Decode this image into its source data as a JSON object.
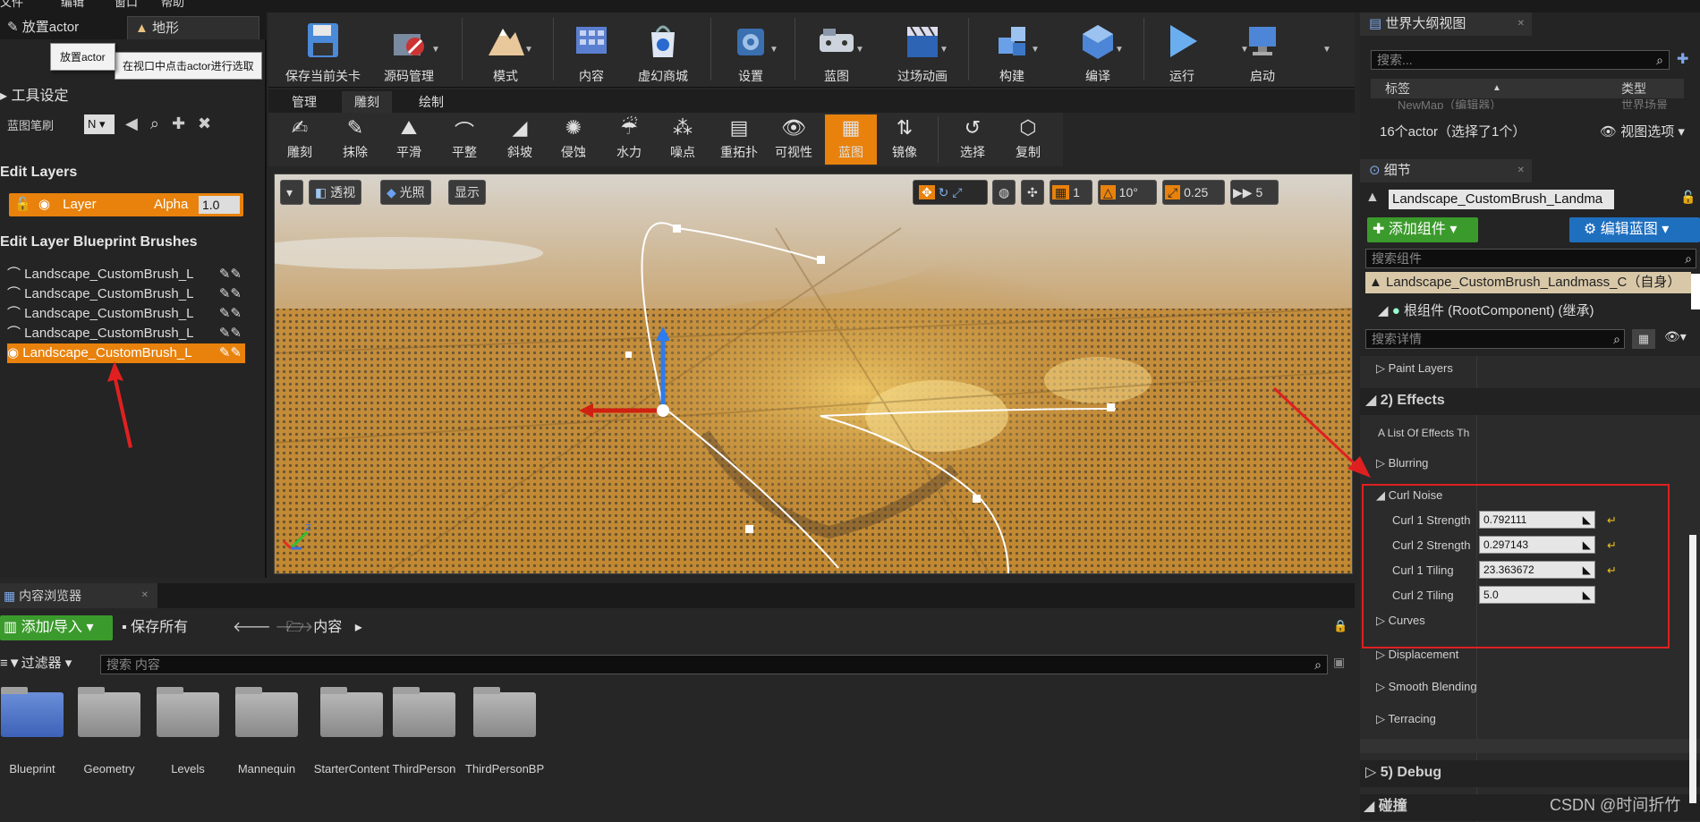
{
  "menu": [
    "文件",
    "编辑",
    "窗口",
    "帮助"
  ],
  "mode_tabs": {
    "place": "放置actor",
    "landscape": "地形"
  },
  "tooltip": {
    "title": "放置actor",
    "hint": "在视口中点击actor进行选取"
  },
  "left": {
    "tool_settings": "工具设定",
    "blueprint_brush_label": "蓝图笔刷",
    "blueprint_brush_value": "N",
    "edit_layers": "Edit Layers",
    "layer_name": "Layer",
    "layer_alpha_label": "Alpha",
    "layer_alpha_value": "1.0",
    "bp_brushes_header": "Edit Layer Blueprint Brushes",
    "brushes": [
      "Landscape_CustomBrush_L",
      "Landscape_CustomBrush_L",
      "Landscape_CustomBrush_L",
      "Landscape_CustomBrush_L",
      "Landscape_CustomBrush_L"
    ]
  },
  "toolbar": [
    "保存当前关卡",
    "源码管理",
    "模式",
    "内容",
    "虚幻商城",
    "设置",
    "蓝图",
    "过场动画",
    "构建",
    "编译",
    "运行",
    "启动"
  ],
  "subtabs": [
    "管理",
    "雕刻",
    "绘制"
  ],
  "sculpt_tools": [
    "雕刻",
    "抹除",
    "平滑",
    "平整",
    "斜坡",
    "侵蚀",
    "水力",
    "噪点",
    "重拓扑",
    "可视性",
    "蓝图",
    "镜像",
    "选择",
    "复制"
  ],
  "viewport": {
    "perspective": "透视",
    "lit": "光照",
    "show": "显示",
    "grid_value": "1",
    "angle_value": "10°",
    "scale_value": "0.25",
    "camera_speed": "5"
  },
  "content_browser": {
    "title": "内容浏览器",
    "add_import": "添加/导入",
    "save_all": "保存所有",
    "path": "内容",
    "filter": "过滤器",
    "search_placeholder": "搜索 内容",
    "folders": [
      "Blueprint",
      "Geometry",
      "Levels",
      "Mannequin",
      "StarterContent",
      "ThirdPerson",
      "ThirdPersonBP"
    ]
  },
  "outliner": {
    "title": "世界大纲视图",
    "search_placeholder": "搜索...",
    "col_label": "标签",
    "col_type": "类型",
    "row_label": "NewMap（编辑器）",
    "row_type": "世界场景",
    "count": "16个actor（选择了1个）",
    "view_options": "视图选项"
  },
  "details": {
    "title": "细节",
    "actor_name": "Landscape_CustomBrush_Landma",
    "add_component": "添加组件",
    "edit_blueprint": "编辑蓝图",
    "search_components": "搜索组件",
    "component_self": "Landscape_CustomBrush_Landmass_C（自身）",
    "root_component": "根组件 (RootComponent) (继承)",
    "search_details": "搜索详情",
    "paint_layers": "Paint Layers",
    "effects_header": "2) Effects",
    "effects_list": "A List Of Effects Th",
    "blurring": "Blurring",
    "curl_noise": "Curl Noise",
    "props": [
      {
        "label": "Curl 1 Strength",
        "value": "0.792111"
      },
      {
        "label": "Curl 2 Strength",
        "value": "0.297143"
      },
      {
        "label": "Curl 1 Tiling",
        "value": "23.363672"
      },
      {
        "label": "Curl 2 Tiling",
        "value": "5.0"
      }
    ],
    "curves": "Curves",
    "displacement": "Displacement",
    "smooth_blending": "Smooth Blending",
    "terracing": "Terracing",
    "debug_header": "5) Debug",
    "collision": "碰撞"
  },
  "watermark": "CSDN @时间折竹",
  "colors": {
    "accent_orange": "#e8820c",
    "highlight_red": "#e02020",
    "add_green": "#3b9a2c",
    "edit_blue": "#1f6fbf"
  }
}
